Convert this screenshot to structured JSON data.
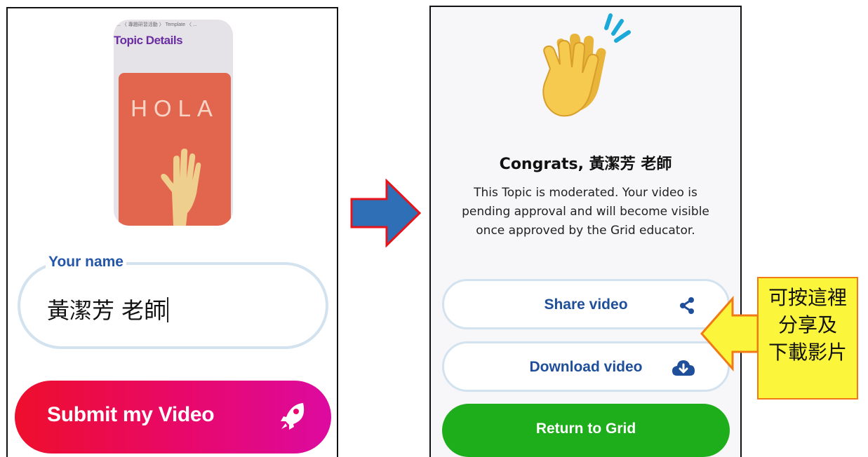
{
  "submission_screen": {
    "thumbnail": {
      "breadcrumb": "... 〈 專題研習活動 〉 Template 〈 ...",
      "topic_title": "Topic Details",
      "card_text": "HOLA"
    },
    "name_field": {
      "label": "Your name",
      "value": "黃潔芳 老師"
    },
    "submit_button": {
      "label": "Submit my Video",
      "icon": "rocket-icon"
    }
  },
  "success_screen": {
    "emoji": "clapping-hands-icon",
    "title": "Congrats, 黃潔芳 老師",
    "message": "This Topic is moderated. Your video is pending approval and will become visible once approved by the Grid educator.",
    "share_button": {
      "label": "Share video",
      "icon": "share-icon"
    },
    "download_button": {
      "label": "Download video",
      "icon": "cloud-download-icon"
    },
    "return_button": {
      "label": "Return to Grid"
    }
  },
  "annotation": {
    "lines": [
      "可按這裡",
      "分享及",
      "下載影片"
    ]
  },
  "colors": {
    "field_border": "#d3e2ef",
    "label_blue": "#2456a8",
    "submit_gradient_start": "#ee0e2c",
    "submit_gradient_end": "#dc0aa0",
    "return_green": "#1fae1b",
    "flow_arrow_fill": "#2f6fb6",
    "flow_arrow_border": "#e8131b",
    "callout_fill": "#fbf63b",
    "callout_border": "#f07a16"
  }
}
